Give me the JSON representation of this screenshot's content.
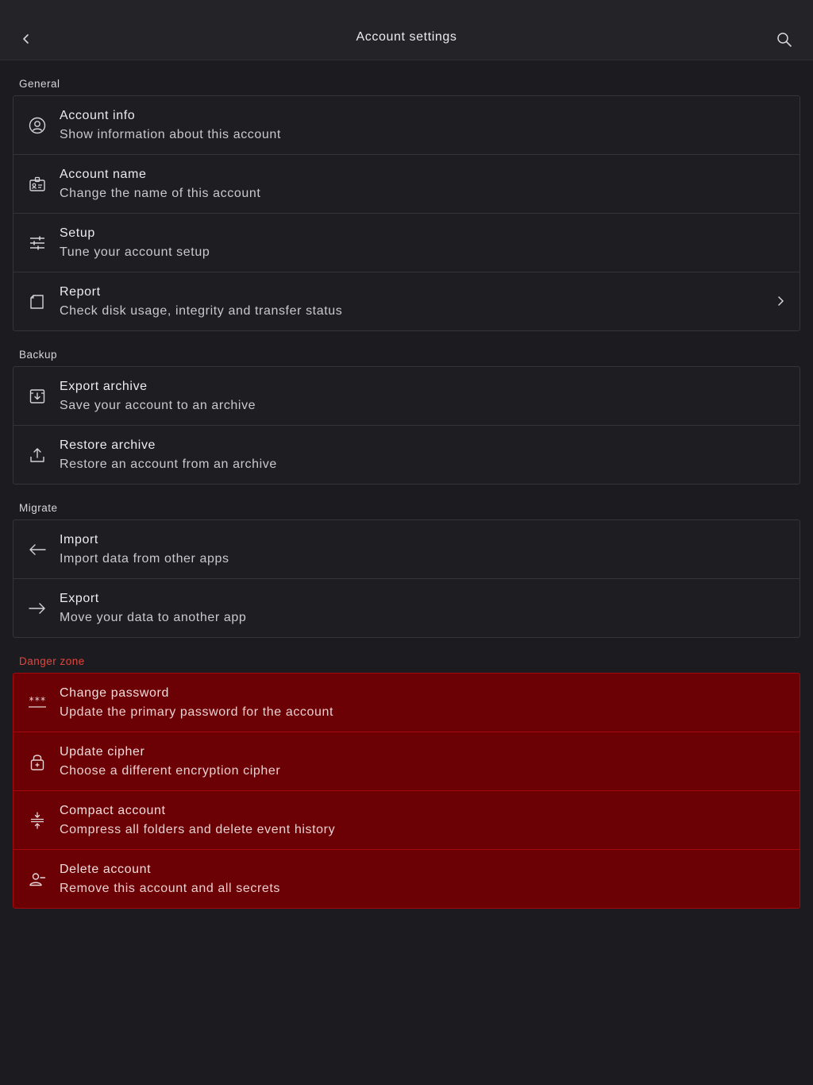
{
  "header": {
    "title": "Account settings",
    "back_icon": "chevron-left-icon",
    "search_icon": "search-icon"
  },
  "sections": [
    {
      "title": "General",
      "items": [
        {
          "label": "Account info",
          "description": "Show information about this account",
          "icon": "user-circle-icon"
        },
        {
          "label": "Account name",
          "description": "Change the name of this account",
          "icon": "id-card-icon"
        },
        {
          "label": "Setup",
          "description": "Tune your account setup",
          "icon": "sliders-icon"
        },
        {
          "label": "Report",
          "description": "Check disk usage, integrity and transfer status",
          "icon": "document-icon",
          "chevron": "chevron-right-icon"
        }
      ]
    },
    {
      "title": "Backup",
      "items": [
        {
          "label": "Export archive",
          "description": "Save your account to an archive",
          "icon": "archive-download-icon"
        },
        {
          "label": "Restore archive",
          "description": "Restore an account from an archive",
          "icon": "upload-icon"
        }
      ]
    },
    {
      "title": "Migrate",
      "items": [
        {
          "label": "Import",
          "description": "Import data from other apps",
          "icon": "arrow-left-icon"
        },
        {
          "label": "Export",
          "description": "Move your data to another app",
          "icon": "arrow-right-icon"
        }
      ]
    },
    {
      "title": "Danger zone",
      "items": [
        {
          "label": "Change password",
          "description": "Update the primary password for the account",
          "icon": "password-icon"
        },
        {
          "label": "Update cipher",
          "description": "Choose a different encryption cipher",
          "icon": "lock-icon"
        },
        {
          "label": "Compact account",
          "description": "Compress all folders and delete event history",
          "icon": "compress-icon"
        },
        {
          "label": "Delete account",
          "description": "Remove this account and all secrets",
          "icon": "user-minus-icon"
        }
      ]
    }
  ],
  "colors": {
    "background": "#1c1c20",
    "header_background": "#242428",
    "danger_background": "#6b0005",
    "danger_border": "#a3090f",
    "danger_label": "#e0463e"
  }
}
